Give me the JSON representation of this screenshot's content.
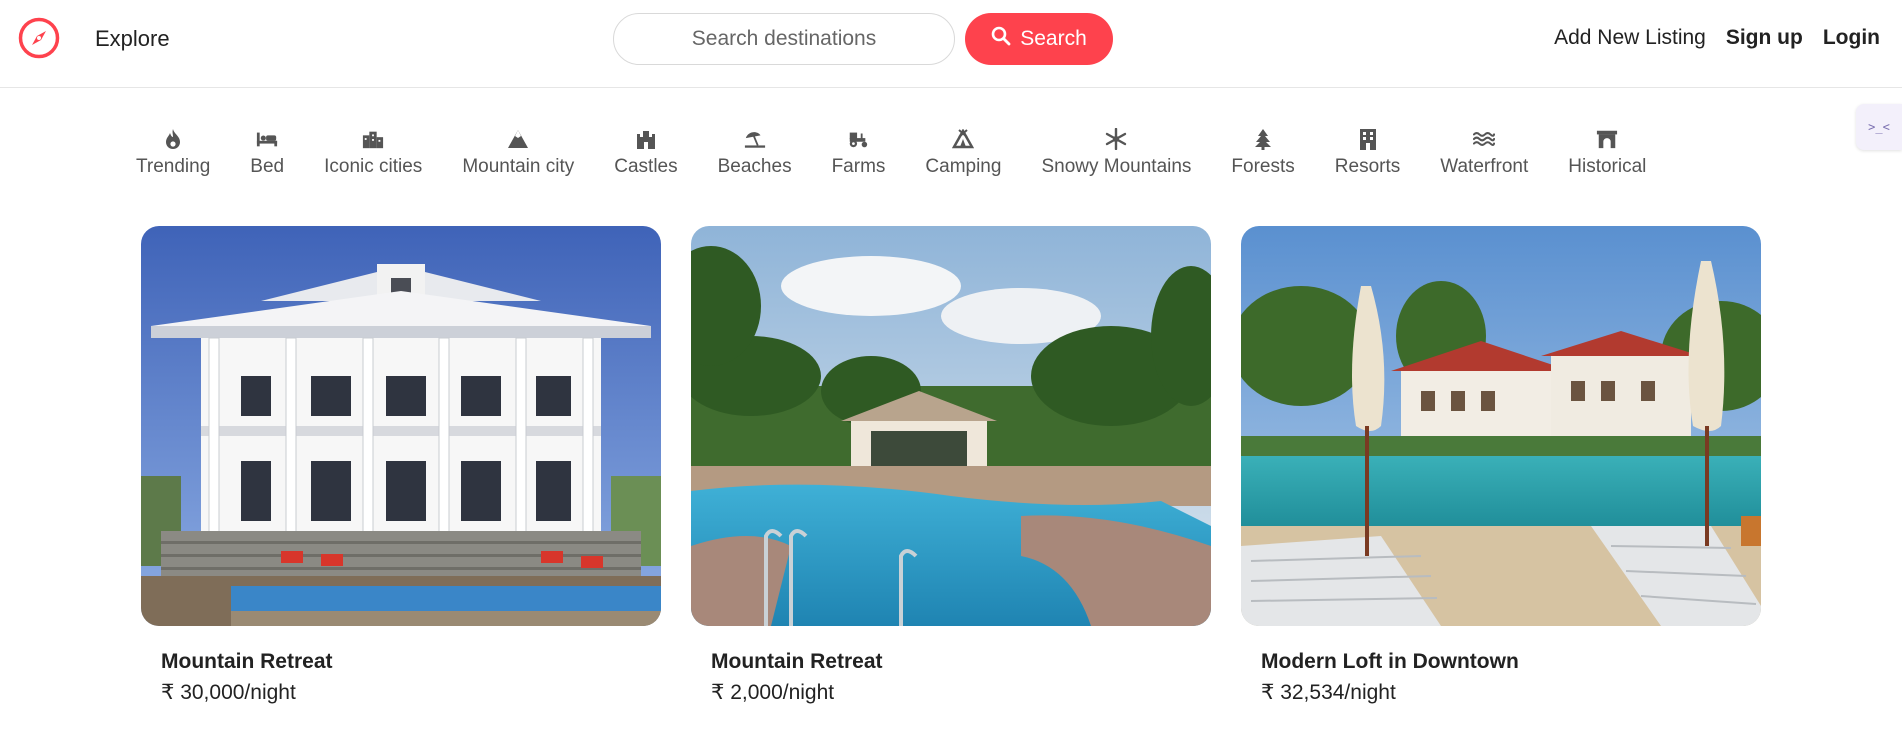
{
  "header": {
    "explore_label": "Explore",
    "search_placeholder": "Search destinations",
    "search_button_label": "Search",
    "add_listing_label": "Add New Listing",
    "signup_label": "Sign up",
    "login_label": "Login",
    "brand_color": "#fe424d"
  },
  "filters": [
    {
      "label": "Trending",
      "icon": "fire-icon"
    },
    {
      "label": "Bed",
      "icon": "bed-icon"
    },
    {
      "label": "Iconic cities",
      "icon": "city-icon"
    },
    {
      "label": "Mountain city",
      "icon": "mountain-icon"
    },
    {
      "label": "Castles",
      "icon": "castle-icon"
    },
    {
      "label": "Beaches",
      "icon": "umbrella-beach-icon"
    },
    {
      "label": "Farms",
      "icon": "tractor-icon"
    },
    {
      "label": "Camping",
      "icon": "campground-icon"
    },
    {
      "label": "Snowy Mountains",
      "icon": "snowflake-icon"
    },
    {
      "label": "Forests",
      "icon": "tree-icon"
    },
    {
      "label": "Resorts",
      "icon": "building-icon"
    },
    {
      "label": "Waterfront",
      "icon": "water-icon"
    },
    {
      "label": "Historical",
      "icon": "archway-icon"
    }
  ],
  "side_tab": {
    "label": ">_<"
  },
  "listings": [
    {
      "title": "Mountain Retreat",
      "price": "₹ 30,000/night",
      "image": "white-villa-with-pool-photo"
    },
    {
      "title": "Mountain Retreat",
      "price": "₹ 2,000/night",
      "image": "tropical-pool-gazebo-photo"
    },
    {
      "title": "Modern Loft in Downtown",
      "price": "₹ 32,534/night",
      "image": "resort-pool-umbrellas-photo"
    }
  ]
}
